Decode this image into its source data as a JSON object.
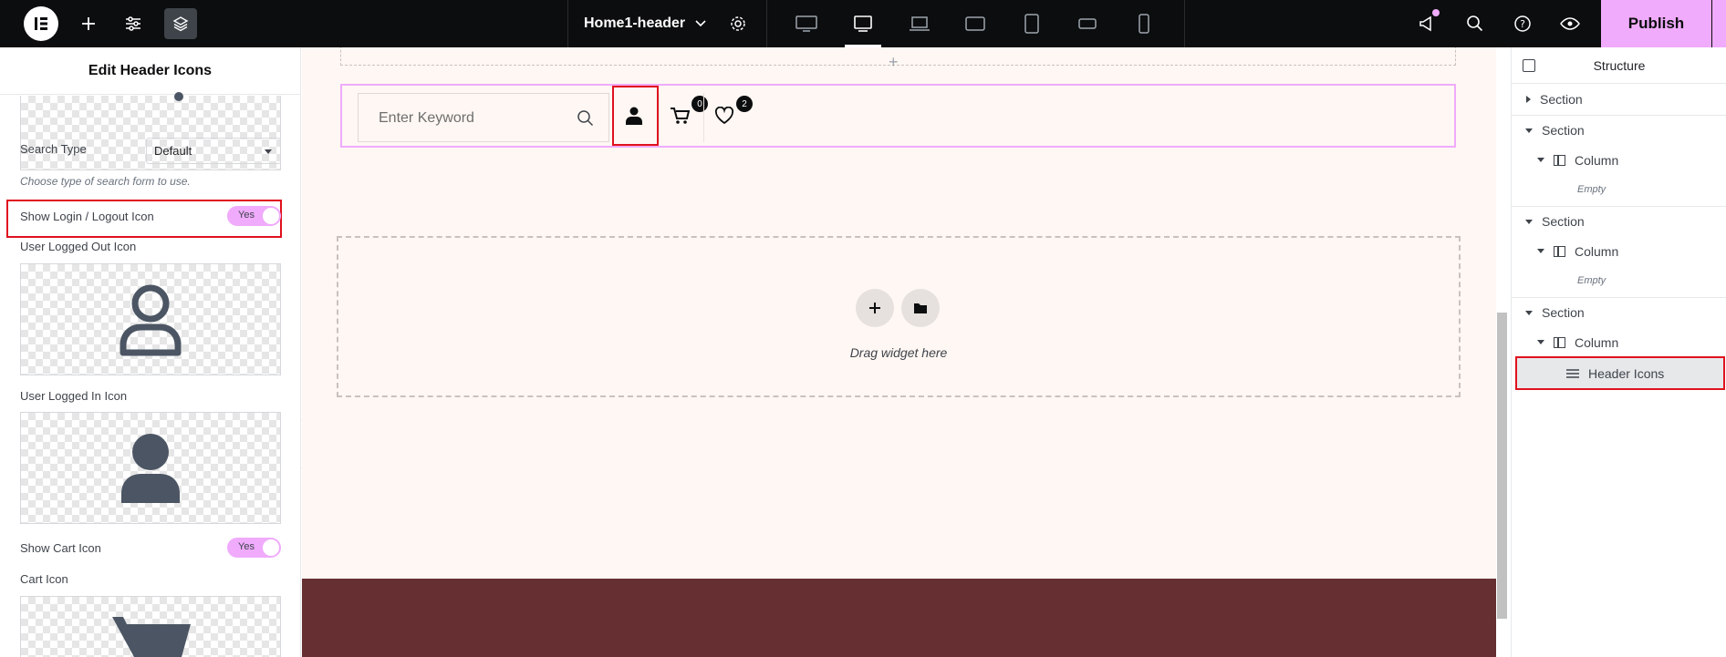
{
  "topbar": {
    "document_title": "Home1-header",
    "publish_label": "Publish",
    "devices": [
      "desktop",
      "tablet-landscape",
      "laptop",
      "tablet-extra",
      "tablet-portrait",
      "mobile-extra",
      "mobile"
    ],
    "active_device": "tablet-landscape",
    "accent_color": "#f0abfc"
  },
  "left_panel": {
    "title": "Edit Header Icons",
    "search_type_label": "Search Type",
    "search_type_value": "Default",
    "search_type_hint": "Choose type of search form to use.",
    "show_login_label": "Show Login / Logout Icon",
    "show_login_toggle": "Yes",
    "logged_out_label": "User Logged Out Icon",
    "logged_in_label": "User Logged In Icon",
    "show_cart_label": "Show Cart Icon",
    "show_cart_toggle": "Yes",
    "cart_icon_label": "Cart Icon"
  },
  "canvas": {
    "search_placeholder": "Enter Keyword",
    "cart_count": "0",
    "wishlist_count": "2",
    "drop_text": "Drag widget here",
    "footer_color": "#662f32"
  },
  "structure": {
    "title": "Structure",
    "items": [
      {
        "label": "Section"
      },
      {
        "label": "Section"
      },
      {
        "label": "Column"
      },
      {
        "label": "Empty"
      },
      {
        "label": "Section"
      },
      {
        "label": "Column"
      },
      {
        "label": "Empty"
      },
      {
        "label": "Section"
      },
      {
        "label": "Column"
      },
      {
        "label": "Header Icons"
      }
    ]
  }
}
